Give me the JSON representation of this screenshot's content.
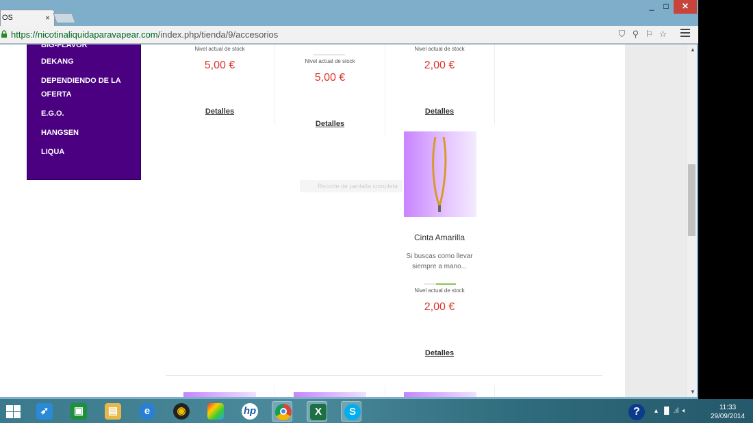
{
  "browser": {
    "tab_title": "OS",
    "tab_close": "×",
    "window_controls": {
      "minimize": "_",
      "maximize": "□",
      "close": "✕"
    },
    "url_host": "https://nicotinaliquidaparavapear.com",
    "url_path": "/index.php/tienda/9/accesorios"
  },
  "sidebar": {
    "background": "#4b0082",
    "items": [
      {
        "label": "BIG-FLAVOR"
      },
      {
        "label": "DEKANG"
      },
      {
        "label": "DEPENDIENDO DE LA"
      },
      {
        "label": "OFERTA"
      },
      {
        "label": "E.G.O."
      },
      {
        "label": "HANGSEN"
      },
      {
        "label": "LIQUA"
      }
    ]
  },
  "products_row1": [
    {
      "stock_label": "Nivel actual de stock",
      "price": "5,00 €",
      "details": "Detalles"
    },
    {
      "stock_label": "Nivel actual de stock",
      "price": "5,00 €",
      "details": "Detalles"
    },
    {
      "stock_label": "Nivel actual de stock",
      "price": "2,00 €",
      "details": "Detalles"
    }
  ],
  "product_featured": {
    "name": "Cinta Amarilla",
    "description_line1": "Si buscas como llevar",
    "description_line2": "siempre a mano...",
    "stock_label": "Nivel actual de stock",
    "price": "2,00 €",
    "details": "Detalles"
  },
  "overlay_text": "Recorte de pantalla completa",
  "colors": {
    "price": "#e0332b",
    "stock_bar": "#8bc34a"
  },
  "taskbar": {
    "apps": [
      "rocket-app",
      "store-app",
      "file-explorer",
      "internet-explorer",
      "media-app",
      "photo-app",
      "hp-app",
      "chrome",
      "excel",
      "skype"
    ],
    "time": "11:33",
    "date": "29/09/2014"
  }
}
